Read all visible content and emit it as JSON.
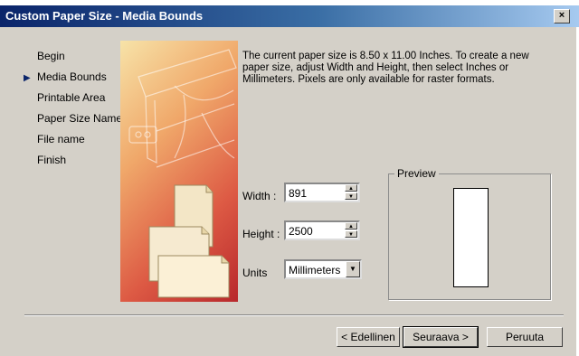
{
  "window": {
    "title": "Custom Paper Size - Media Bounds",
    "close_glyph": "×"
  },
  "steps": [
    {
      "label": "Begin",
      "current": false
    },
    {
      "label": "Media Bounds",
      "current": true
    },
    {
      "label": "Printable Area",
      "current": false
    },
    {
      "label": "Paper Size Name",
      "current": false
    },
    {
      "label": "File name",
      "current": false
    },
    {
      "label": "Finish",
      "current": false
    }
  ],
  "current_step_marker": "▶",
  "illustration": {
    "icon": "printer-and-paper-illustration"
  },
  "description": "The current paper size is 8.50 x 11.00 Inches. To create a new paper size, adjust Width and Height, then select Inches or Millimeters. Pixels are only available for raster formats.",
  "form": {
    "width_label": "Width :",
    "width_value": "891",
    "height_label": "Height :",
    "height_value": "2500",
    "units_label": "Units",
    "units_value": "Millimeters"
  },
  "preview": {
    "label": "Preview"
  },
  "buttons": {
    "back": "< Edellinen",
    "next": "Seuraava >",
    "cancel": "Peruuta"
  }
}
